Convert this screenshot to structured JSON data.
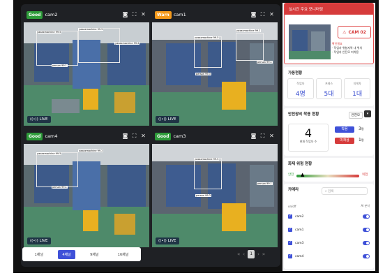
{
  "cameras": [
    {
      "status": "Good",
      "name": "cam2",
      "live": "LIVE",
      "tags": [
        "yaxaxmachine 99.5",
        "yaxaxmachine 99.5",
        "yaxaxmachine 99.2",
        "person 99.1"
      ]
    },
    {
      "status": "Warn",
      "name": "cam1",
      "live": "LIVE",
      "tags": [
        "yaxaxmachine 99.5",
        "yaxaxmachine 99.1",
        "person 99.3",
        "person 99.1"
      ]
    },
    {
      "status": "Good",
      "name": "cam4",
      "live": "LIVE",
      "tags": [
        "yaxaxmachine 99.5",
        "yaxaxmachine 99.2",
        "person 99.1"
      ]
    },
    {
      "status": "Good",
      "name": "cam3",
      "live": "LIVE",
      "tags": [
        "yaxaxmachine 99.5",
        "person 99.3",
        "person 99.1"
      ]
    }
  ],
  "layout_buttons": [
    "1채널",
    "4채널",
    "9채널",
    "16채널"
  ],
  "active_layout": "4채널",
  "pagination": {
    "current": "1",
    "prev": "‹",
    "first": "«",
    "next": "›",
    "last": "»"
  },
  "alert": {
    "title": "실시간 주요 모니터링",
    "cam": "CAM 02",
    "label": "확인필요",
    "lines": [
      "· 작업자 위험지역 내 위치",
      "· 작업자 안전모 미착용"
    ]
  },
  "operation": {
    "title": "가동현황",
    "stats": [
      {
        "label": "작업자",
        "value": "4명"
      },
      {
        "label": "프레스",
        "value": "5대"
      },
      {
        "label": "지게차",
        "value": "1대"
      }
    ]
  },
  "safety": {
    "title": "안전장비 착용 현황",
    "select": "안전모",
    "count": "4",
    "count_label": "현재 작업자 수",
    "wearing_label": "착용",
    "wearing_count": "3",
    "not_label": "미착용",
    "not_count": "1",
    "unit": "명"
  },
  "fire": {
    "title": "화재 위험 현황",
    "low": "안전",
    "high": "위험"
  },
  "camera_list": {
    "title": "카메라",
    "search_placeholder": "검색",
    "header_left": "on/off",
    "header_right": "AI 분석",
    "items": [
      "cam2",
      "cam1",
      "cam3",
      "cam4"
    ]
  },
  "colors": {
    "good": "#2e9b3a",
    "warn": "#f59a1c",
    "accent": "#3f51d8",
    "danger": "#d63b3b"
  }
}
